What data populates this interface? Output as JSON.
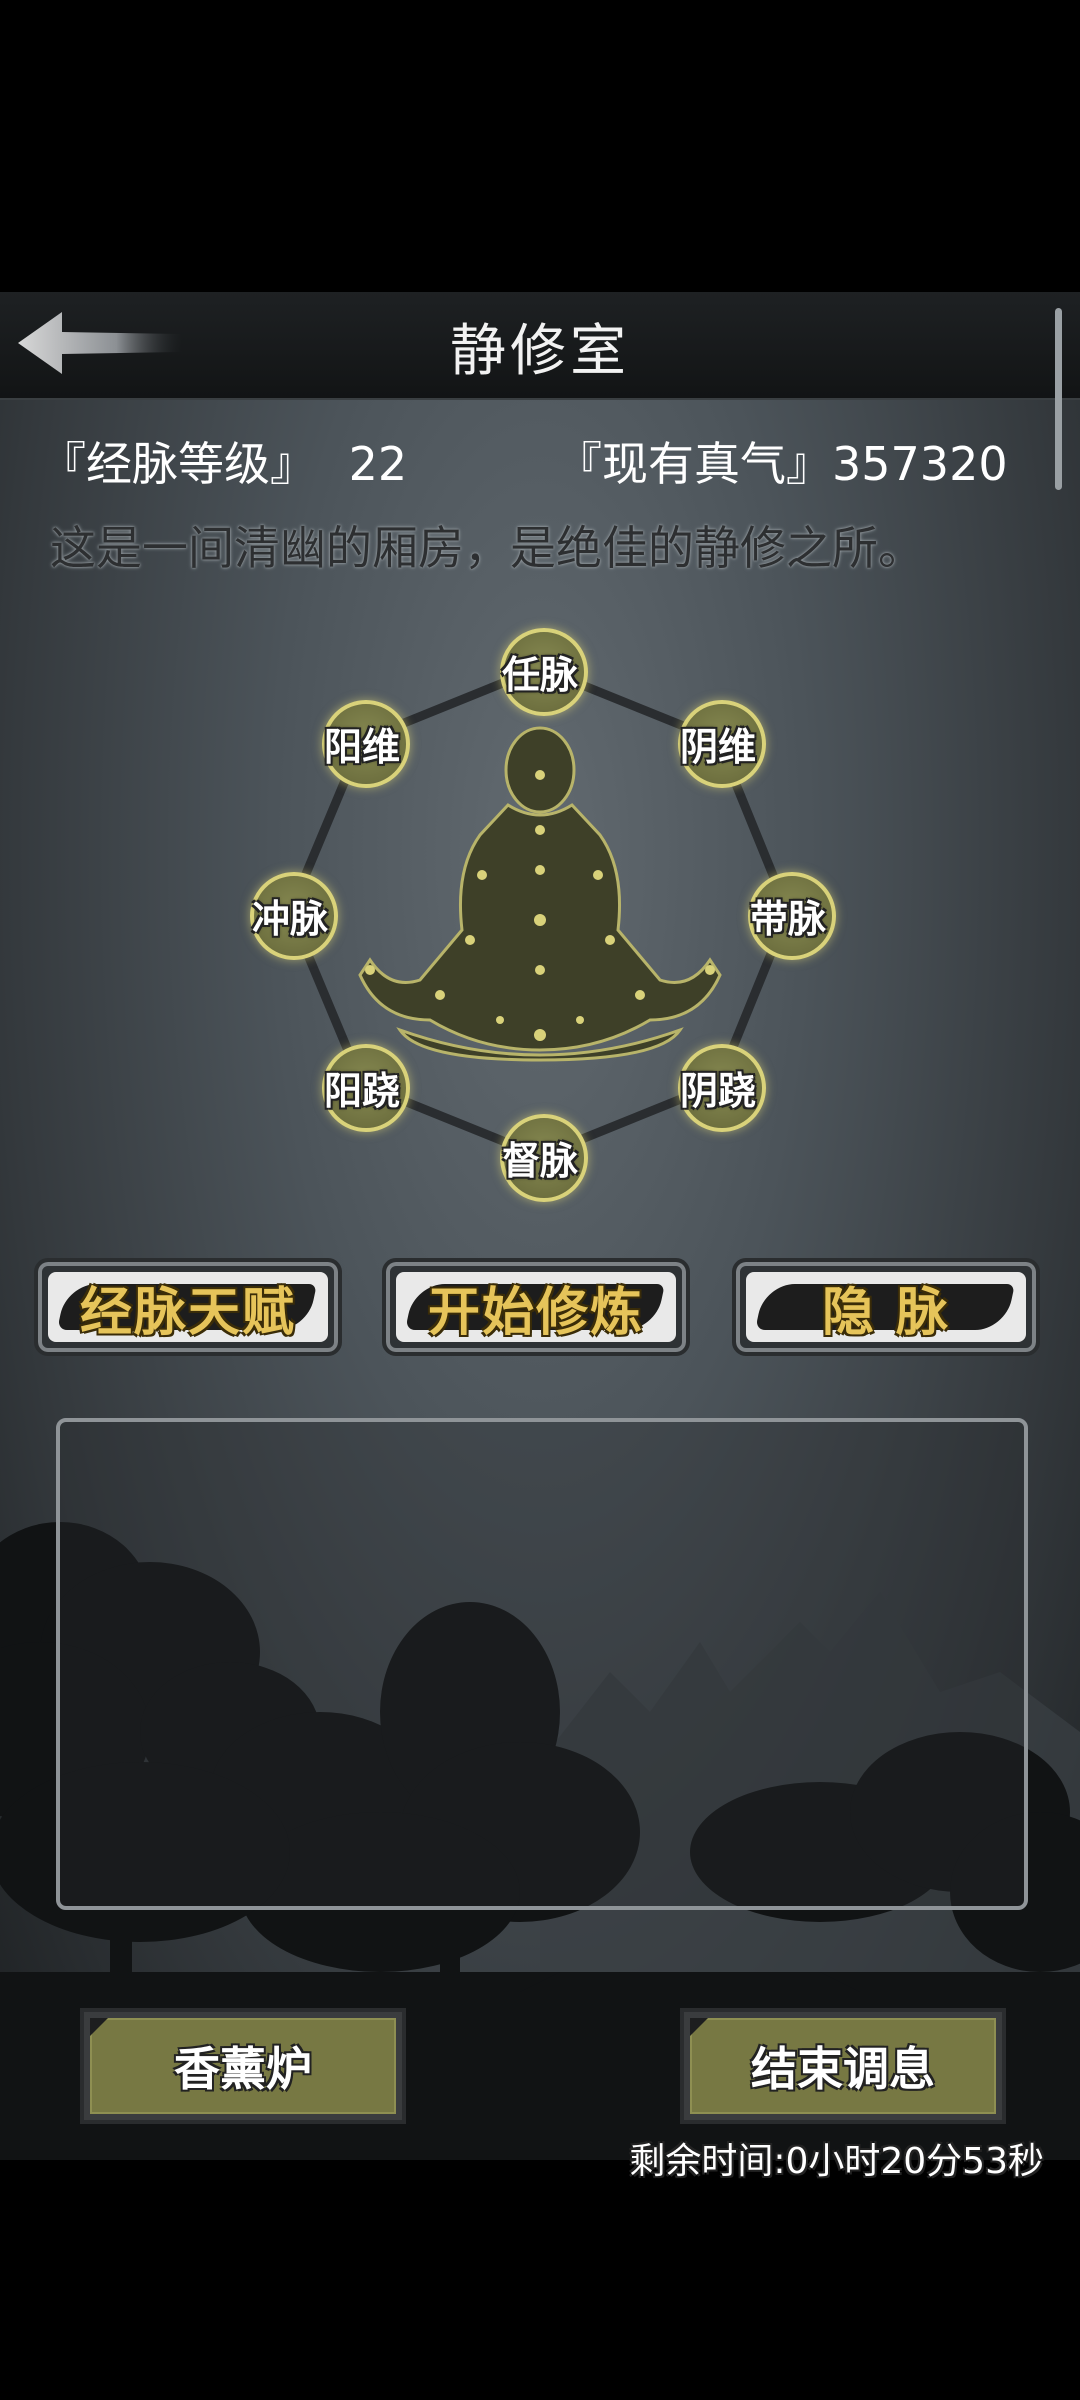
{
  "header": {
    "title": "静修室",
    "back_icon": "back-arrow-icon"
  },
  "stats": {
    "meridian_level_label": "『经脉等级』",
    "meridian_level_value": "22",
    "qi_label": "『现有真气』",
    "qi_value": "357320"
  },
  "description": "这是一间清幽的厢房，是绝佳的静修之所。",
  "meridians": [
    "任脉",
    "阴维",
    "带脉",
    "阴跷",
    "督脉",
    "阳跷",
    "冲脉",
    "阳维"
  ],
  "actions": {
    "talent": "经脉天赋",
    "start": "开始修炼",
    "hidden": "隐 脉"
  },
  "footer": {
    "incense": "香薰炉",
    "end_rest": "结束调息",
    "time_left": "剩余时间:0小时20分53秒"
  },
  "colors": {
    "node_fill": "#6f7140",
    "node_ring": "#d9d27a",
    "button_gold_text": "#e6c45a",
    "olive_button": "#777843"
  }
}
